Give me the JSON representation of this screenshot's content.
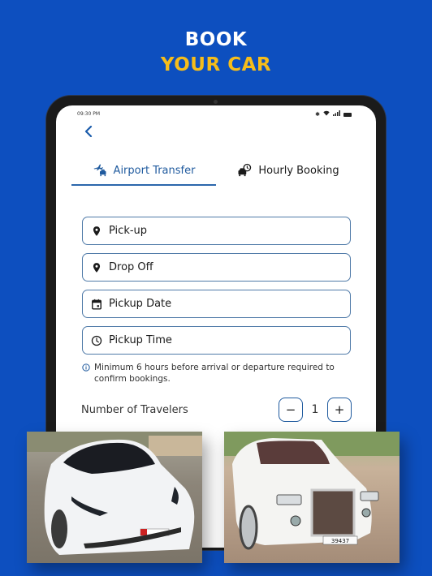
{
  "hero": {
    "line1": "BOOK",
    "line2": "YOUR CAR"
  },
  "colors": {
    "background": "#0d4fbf",
    "accent_yellow": "#f6bd1a",
    "primary_blue": "#1f5a9e"
  },
  "statusbar": {
    "time": "09:30 PM",
    "icons": [
      "bluetooth-icon",
      "wifi-icon",
      "signal-icon",
      "battery-icon"
    ]
  },
  "nav": {
    "back_icon": "chevron-left-icon"
  },
  "tabs": [
    {
      "label": "Airport Transfer",
      "icon": "airplane-car-icon",
      "active": true
    },
    {
      "label": "Hourly Booking",
      "icon": "car-clock-icon",
      "active": false
    }
  ],
  "form": {
    "pickup_placeholder": "Pick-up",
    "dropoff_placeholder": "Drop Off",
    "date_placeholder": "Pickup Date",
    "time_placeholder": "Pickup Time"
  },
  "info_note": "Minimum 6 hours before arrival or departure required to confirm bookings.",
  "travelers": {
    "label": "Number of Travelers",
    "count": "1",
    "minus": "−",
    "plus": "+"
  },
  "photos": [
    {
      "alt": "White Tesla Model 3"
    },
    {
      "alt": "White Rolls-Royce Phantom",
      "plate": "39437"
    }
  ]
}
